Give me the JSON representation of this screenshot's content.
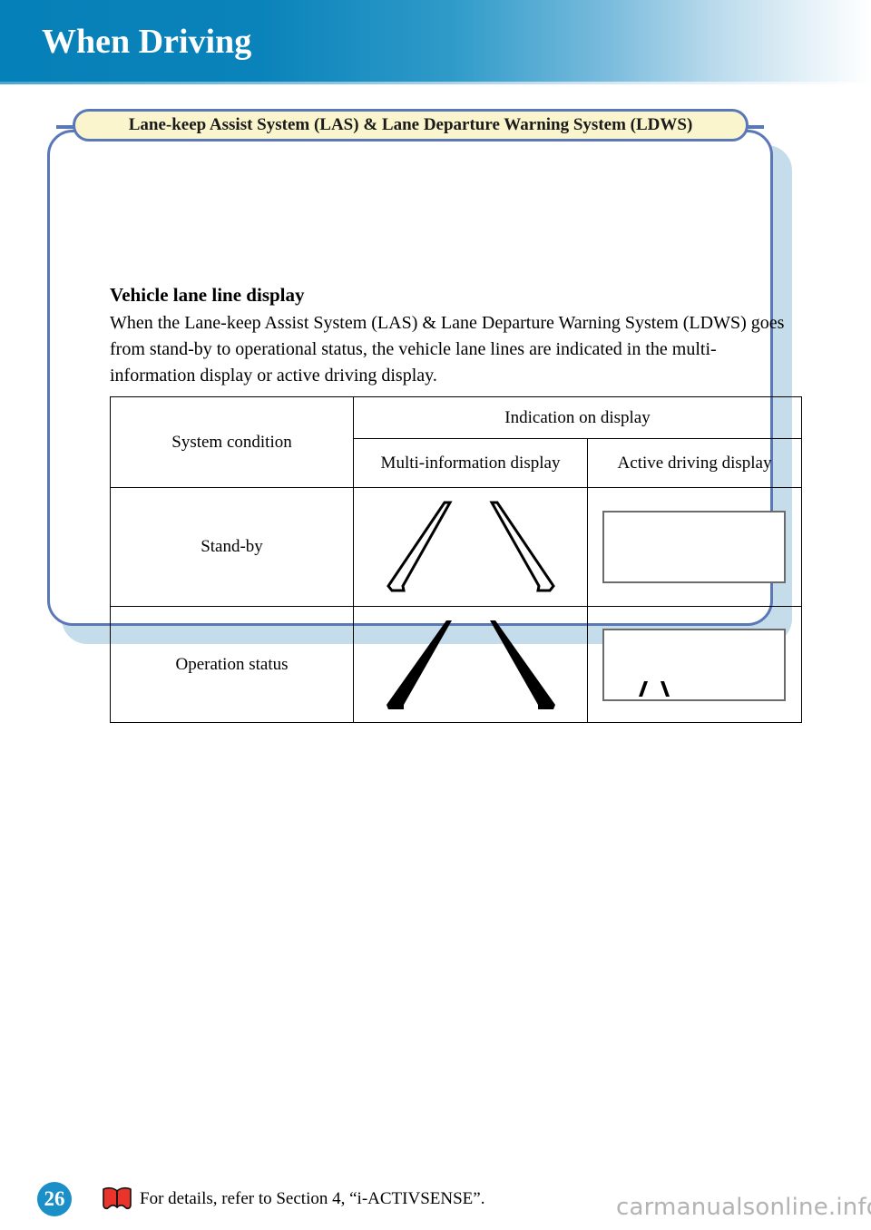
{
  "header": {
    "title": "When Driving",
    "band_color": "#0680b8"
  },
  "section": {
    "pill_title": "Lane-keep Assist System (LAS) & Lane Departure Warning System (LDWS)",
    "pill_fill": "#fbf5cd",
    "border_color": "#5a77b8"
  },
  "content": {
    "subheading": "Vehicle lane line display",
    "paragraph": "When the Lane-keep Assist System (LAS) & Lane Departure Warning System (LDWS) goes from stand-by to operational status, the vehicle lane lines are indicated in the multi-information display or active driving display."
  },
  "table": {
    "col_condition_header": "System condition",
    "col_group_header": "Indication on display",
    "col_multi_header": "Multi-information display",
    "col_add_header": "Active driving display",
    "rows": [
      {
        "label": "Stand-by",
        "multi_info_graphic": "lane-lines-outline",
        "active_driving_graphic": "empty-display-rectangle"
      },
      {
        "label": "Operation status",
        "multi_info_graphic": "lane-lines-solid",
        "active_driving_graphic": "display-rectangle-with-lane-marks"
      }
    ]
  },
  "footer": {
    "page_number": "26",
    "note_icon": "open-book-icon",
    "note_text": "For details, refer to Section 4, “i-ACTIVSENSE”.",
    "watermark": "carmanualsonline.info",
    "badge_color": "#1a8fc8",
    "book_color": "#e8342a"
  }
}
